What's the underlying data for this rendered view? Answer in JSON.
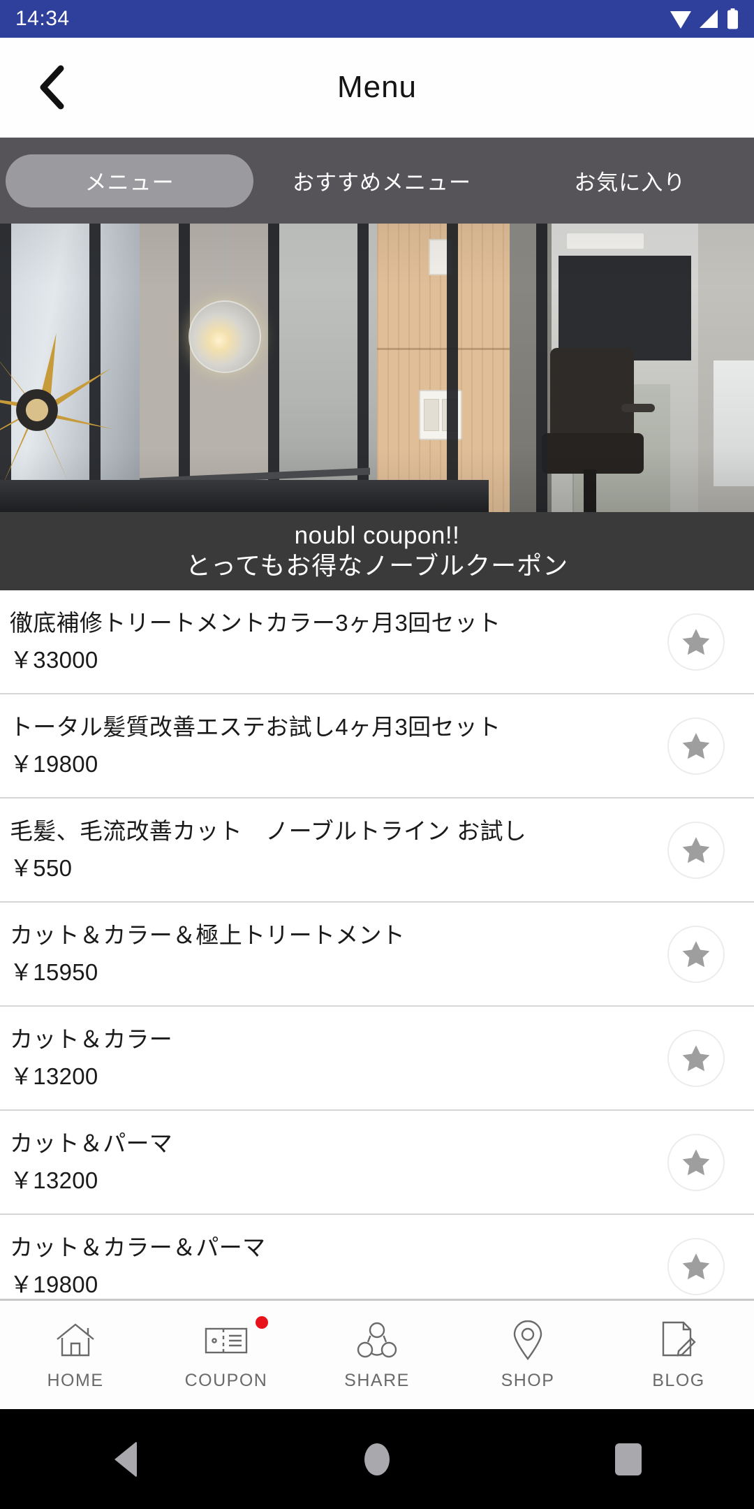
{
  "status_bar": {
    "time": "14:34",
    "icons": [
      "wifi-icon",
      "signal-icon",
      "battery-icon"
    ],
    "background_color": "#2f409c"
  },
  "header": {
    "back_label": "back-chevron-icon",
    "title": "Menu"
  },
  "tabs": {
    "background_color": "#565459",
    "active_pill_color": "#9b9a9e",
    "items": [
      {
        "label": "メニュー",
        "active": true
      },
      {
        "label": "おすすめメニュー",
        "active": false
      },
      {
        "label": "お気に入り",
        "active": false
      }
    ]
  },
  "banner": {
    "alt": "salon interior with glass pendant lamp, wood paneling and styling chair",
    "caption_en": "noubl coupon!!",
    "caption_jp": "とってもお得なノーブルクーポン",
    "caption_background": "#3b3a3a"
  },
  "menu_list": {
    "favorite_icon": "star-icon",
    "items": [
      {
        "title": "徹底補修トリートメントカラー3ヶ月3回セット",
        "price": "￥33000"
      },
      {
        "title": "トータル髪質改善エステお試し4ヶ月3回セット",
        "price": "￥19800"
      },
      {
        "title": "毛髪、毛流改善カット　ノーブルトライン お試し",
        "price": "￥550"
      },
      {
        "title": "カット＆カラー＆極上トリートメント",
        "price": "￥15950"
      },
      {
        "title": "カット＆カラー",
        "price": "￥13200"
      },
      {
        "title": "カット＆パーマ",
        "price": "￥13200"
      },
      {
        "title": "カット＆カラー＆パーマ",
        "price": "￥19800"
      }
    ]
  },
  "bottom_nav": {
    "items": [
      {
        "label": "HOME",
        "icon": "home-icon",
        "badge": false
      },
      {
        "label": "COUPON",
        "icon": "ticket-icon",
        "badge": true
      },
      {
        "label": "SHARE",
        "icon": "share-nodes-icon",
        "badge": false
      },
      {
        "label": "SHOP",
        "icon": "map-pin-icon",
        "badge": false
      },
      {
        "label": "BLOG",
        "icon": "document-pencil-icon",
        "badge": false
      }
    ],
    "badge_color": "#e8131a"
  },
  "system_nav": {
    "buttons": [
      "back-triangle-icon",
      "home-circle-icon",
      "recents-square-icon"
    ]
  }
}
